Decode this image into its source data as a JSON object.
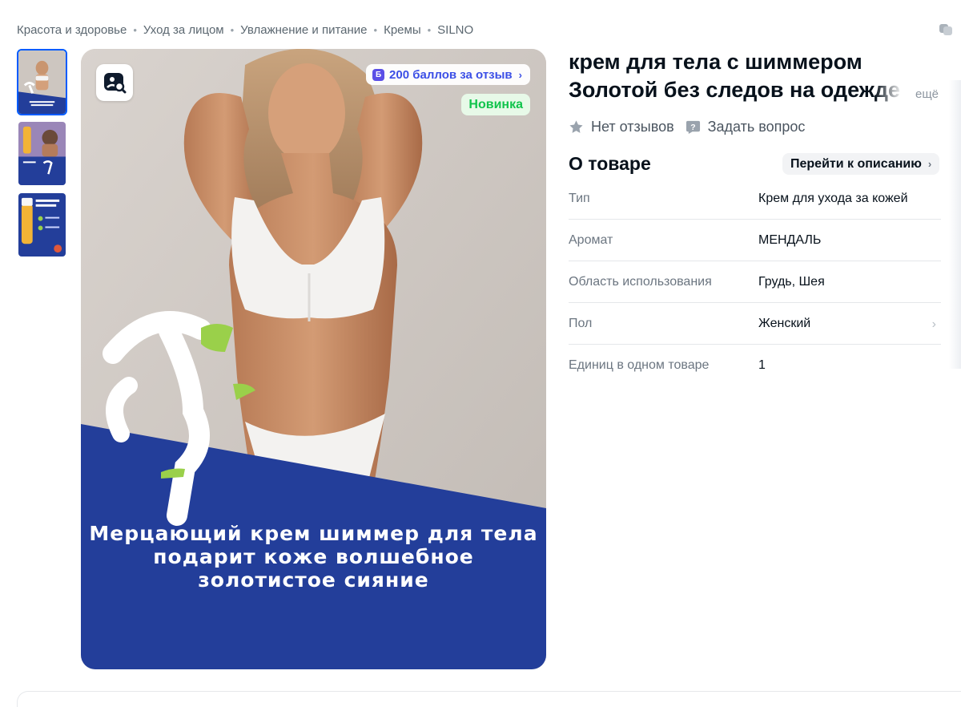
{
  "breadcrumb": [
    "Красота и здоровье",
    "Уход за лицом",
    "Увлажнение и питание",
    "Кремы",
    "SILNO"
  ],
  "breadcrumb_separator": "•",
  "icons": {
    "share": "share-icon",
    "zoom": "image-search-icon",
    "star": "star-icon",
    "question": "question-icon"
  },
  "gallery": {
    "points_badge": {
      "coin": "Б",
      "label": "200 баллов за отзыв",
      "chevron": "›"
    },
    "new_badge": "Новинка",
    "promo_text": [
      "Мерцающий крем шиммер для тела",
      "подарит коже волшебное",
      "золотистое сияние"
    ],
    "colors": {
      "brand_blue": "#233e9a",
      "accent_green": "#9ad04a"
    }
  },
  "product": {
    "title": "крем для тела с шиммером Золотой без следов на одежде",
    "more_label": "ещё",
    "reviews_label": "Нет отзывов",
    "ask_label": "Задать вопрос"
  },
  "about": {
    "heading": "О товаре",
    "goto_label": "Перейти к описанию",
    "goto_chevron": "›",
    "specs": [
      {
        "key": "Тип",
        "value": "Крем для ухода за кожей"
      },
      {
        "key": "Аромат",
        "value": "МЕНДАЛЬ"
      },
      {
        "key": "Область использования",
        "value": "Грудь, Шея"
      },
      {
        "key": "Пол",
        "value": "Женский"
      },
      {
        "key": "Единиц в одном товаре",
        "value": "1"
      }
    ]
  }
}
